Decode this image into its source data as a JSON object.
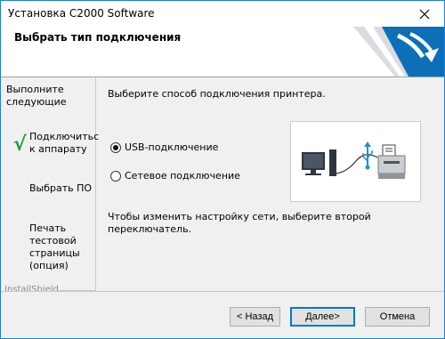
{
  "window": {
    "title": "Установка C2000 Software"
  },
  "header": {
    "title": "Выбрать тип подключения"
  },
  "sidebar": {
    "heading": "Выполните следующие",
    "steps": [
      {
        "label": "Подключитьс к аппарату",
        "done": true
      },
      {
        "label": "Выбрать ПО",
        "done": false
      },
      {
        "label": "Печать тестовой страницы (опция)",
        "done": false
      }
    ],
    "brand": "InstallShield"
  },
  "main": {
    "prompt": "Выберите способ подключения принтера.",
    "options": [
      {
        "label": "USB-подключение",
        "selected": true
      },
      {
        "label": "Сетевое подключение",
        "selected": false
      }
    ],
    "note": "Чтобы изменить настройку сети, выберите второй переключатель."
  },
  "buttons": {
    "back": "< Назад",
    "next": "Далее>",
    "cancel": "Отмена"
  },
  "colors": {
    "accent": "#0078d7",
    "check": "#1f9e3f",
    "usb": "#1f8fd6"
  },
  "icons": [
    "close-icon",
    "checkmark-icon",
    "computer-icon",
    "usb-icon",
    "printer-icon"
  ]
}
